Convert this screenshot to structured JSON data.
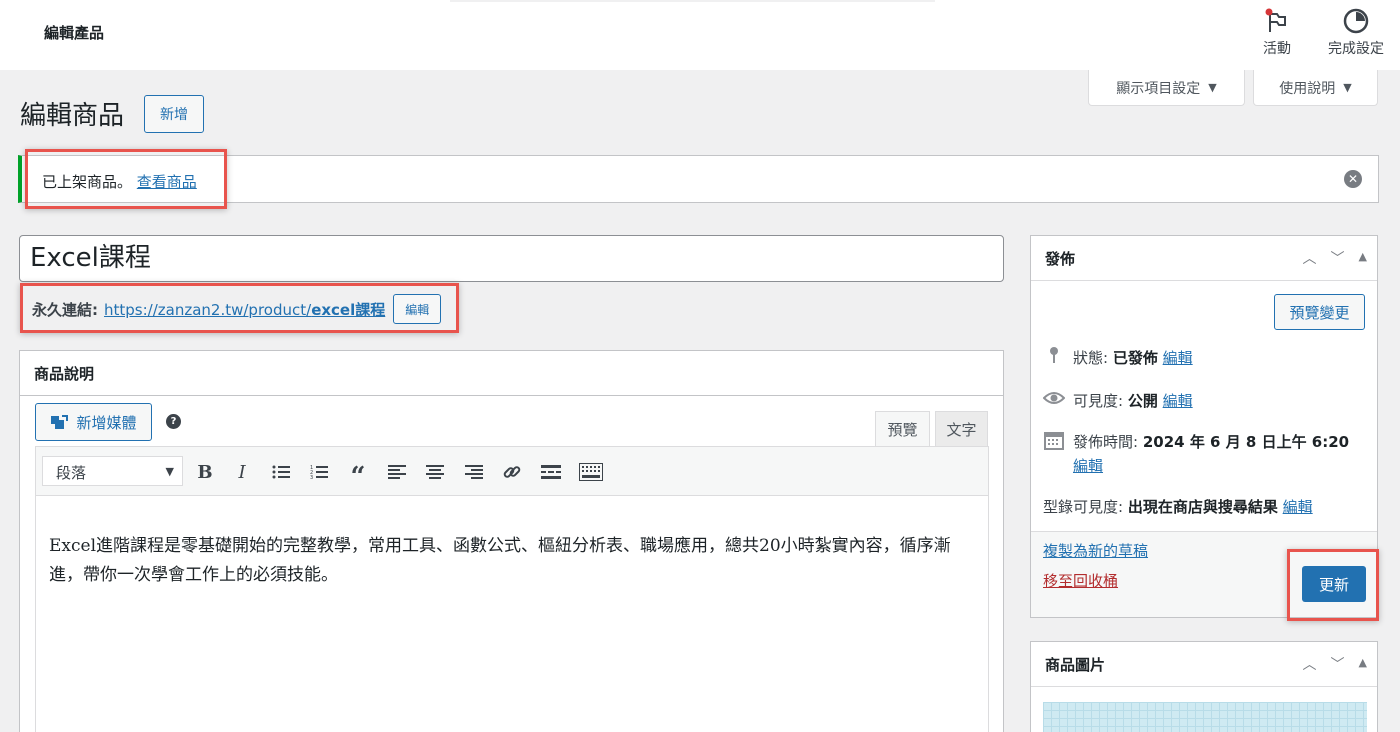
{
  "topbar": {
    "title": "編輯產品",
    "activity_label": "活動",
    "finish_label": "完成設定"
  },
  "screen_options": {
    "display_label": "顯示項目設定",
    "help_label": "使用說明"
  },
  "page": {
    "title": "編輯商品",
    "add_new_label": "新增"
  },
  "notice": {
    "message": "已上架商品。",
    "link_text": "查看商品"
  },
  "post": {
    "title": "Excel課程",
    "permalink_label": "永久連結:",
    "permalink_prefix": "https://zanzan2.tw/product/",
    "permalink_slug": "excel課程",
    "permalink_edit": "編輯"
  },
  "description": {
    "heading": "商品說明",
    "add_media_label": "新增媒體",
    "tab_preview": "預覽",
    "tab_text": "文字",
    "format_select": "段落",
    "content": "Excel進階課程是零基礎開始的完整教學，常用工具、函數公式、樞紐分析表、職場應用，總共20小時紮實內容，循序漸進，帶你一次學會工作上的必須技能。",
    "toolbar_icons": [
      "bold-icon",
      "italic-icon",
      "bullet-list-icon",
      "numbered-list-icon",
      "blockquote-icon",
      "align-left-icon",
      "align-center-icon",
      "align-right-icon",
      "link-icon",
      "read-more-icon",
      "toolbar-toggle-icon"
    ]
  },
  "publish": {
    "heading": "發佈",
    "preview_changes": "預覽變更",
    "status_label": "狀態:",
    "status_value": "已發佈",
    "visibility_label": "可見度:",
    "visibility_value": "公開",
    "published_label": "發佈時間:",
    "published_value": "2024 年 6 月 8 日上午 6:20",
    "catalog_label": "型錄可見度:",
    "catalog_value": "出現在商店與搜尋結果",
    "edit_link": "編輯",
    "duplicate_link": "複製為新的草稿",
    "trash_link": "移至回收桶",
    "update_label": "更新"
  },
  "product_image": {
    "heading": "商品圖片"
  },
  "colors": {
    "accent": "#2271b1",
    "highlight": "#e8544d",
    "success": "#00a32a",
    "danger": "#b32d2e"
  }
}
